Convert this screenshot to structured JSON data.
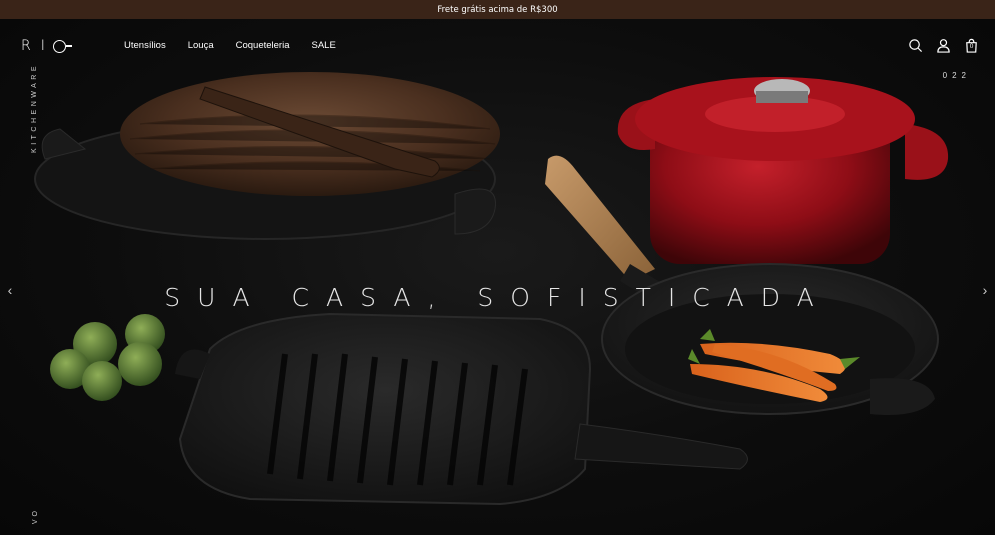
{
  "announcement": "Frete grátis acima de R$300",
  "logo": {
    "text": "RI"
  },
  "nav": {
    "items": [
      "Utensílios",
      "Louça",
      "Coqueteleria",
      "SALE"
    ]
  },
  "header_icons": [
    "search-icon",
    "user-icon",
    "bag-icon"
  ],
  "cart_count": "0",
  "side_label": "KITCHENWARE",
  "bottom_side_label": "VO",
  "slide_counter": "022",
  "hero": {
    "headline": "SUA CASA, SOFISTICADA"
  },
  "arrows": {
    "prev": "‹",
    "next": "›"
  },
  "colors": {
    "announcement_bg": "#3a2418",
    "pot_red": "#8e0d16",
    "background": "#0b0b0b"
  }
}
